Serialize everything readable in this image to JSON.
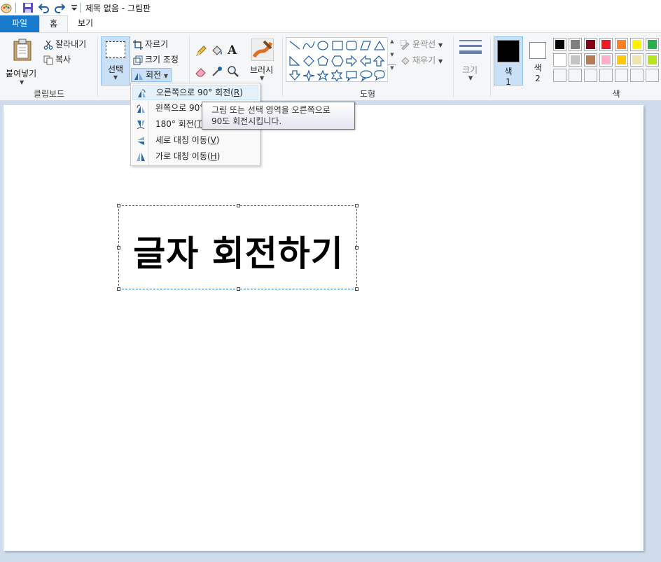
{
  "window": {
    "title": "제목 없음 - 그림판"
  },
  "tabs": {
    "file": "파일",
    "home": "홈",
    "view": "보기"
  },
  "ribbon": {
    "clipboard": {
      "paste": "붙여넣기",
      "cut": "잘라내기",
      "copy": "복사",
      "label": "클립보드"
    },
    "image": {
      "select": "선택",
      "crop": "자르기",
      "resize": "크기 조정",
      "rotate": "회전"
    },
    "brushes": {
      "label": "브러시"
    },
    "shapes": {
      "outline": "윤곽선",
      "fill": "채우기",
      "label": "도형"
    },
    "size": {
      "label": "크기"
    },
    "colors": {
      "color1_label": "색",
      "color1_num": "1",
      "color2_label": "색",
      "color2_num": "2",
      "label": "색",
      "color1_value": "#000000",
      "color2_value": "#ffffff",
      "palette": [
        "#000000",
        "#7f7f7f",
        "#880015",
        "#ed1c24",
        "#ff7f27",
        "#fff200",
        "#22b14c",
        "#ffffff",
        "#c3c3c3",
        "#b97a57",
        "#ffaec9",
        "#ffc90e",
        "#efe4b0",
        "#b5e61d",
        "",
        "",
        "",
        "",
        "",
        "",
        ""
      ]
    }
  },
  "rotate_menu": {
    "items": [
      {
        "label": "오른쪽으로 90° 회전(",
        "key": "R",
        "icon": "rotate-right-icon"
      },
      {
        "label": "왼쪽으로 90° 회전(",
        "key": "L",
        "icon": "rotate-left-icon"
      },
      {
        "label": "180° 회전(",
        "key": "T",
        "icon": "rotate-180-icon"
      },
      {
        "label": "세로 대칭 이동(",
        "key": "V",
        "icon": "flip-vertical-icon"
      },
      {
        "label": "가로 대칭 이동(",
        "key": "H",
        "icon": "flip-horizontal-icon"
      }
    ],
    "close_paren": ")"
  },
  "tooltip": {
    "line1": "그림 또는 선택 영역을 오른쪽으로",
    "line2": "90도 회전시킵니다."
  },
  "canvas": {
    "text": "글자 회전하기"
  }
}
